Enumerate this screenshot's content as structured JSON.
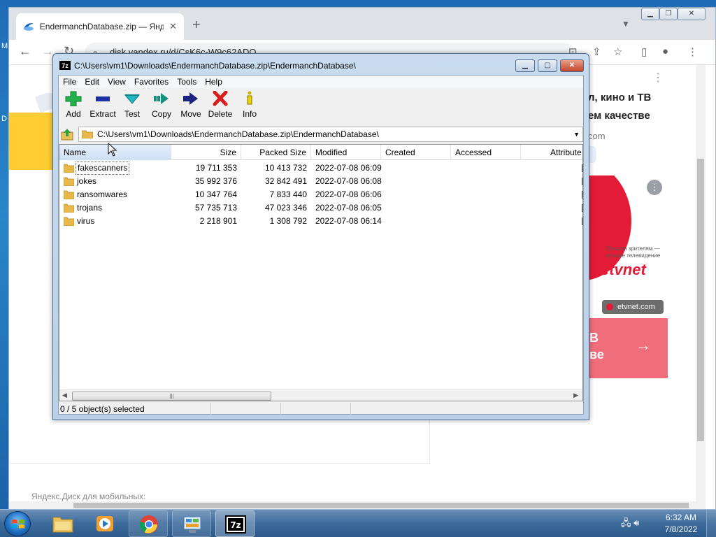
{
  "browser": {
    "tab_title": "EndermanchDatabase.zip — Яндекс.Диск",
    "url": "disk.yandex.ru/d/CsK6c-W9c62ADQ",
    "tab_close": "✕",
    "new_tab": "+",
    "page": {
      "promo_line1": "л, кино и ТВ",
      "promo_line2": "ем качестве",
      "promo_line3": "com",
      "ad_tagline": "Лучшим зрителям — лучшее телевидение",
      "ad_logo": "etvnet",
      "ad_domain": "etvnet.com",
      "ad_bottom_line1": "В",
      "ad_bottom_line2": "ве",
      "footer": "Яндекс.Диск для мобильных:"
    }
  },
  "desktop": {
    "edge_label_m": "M",
    "edge_label_d": "D"
  },
  "zip": {
    "title": "C:\\Users\\vm1\\Downloads\\EndermanchDatabase.zip\\EndermanchDatabase\\",
    "app_icon": "7z",
    "menu": [
      "File",
      "Edit",
      "View",
      "Favorites",
      "Tools",
      "Help"
    ],
    "toolbar": [
      {
        "label": "Add",
        "icon": "add-icon"
      },
      {
        "label": "Extract",
        "icon": "extract-icon"
      },
      {
        "label": "Test",
        "icon": "test-icon"
      },
      {
        "label": "Copy",
        "icon": "copy-icon"
      },
      {
        "label": "Move",
        "icon": "move-icon"
      },
      {
        "label": "Delete",
        "icon": "delete-icon"
      },
      {
        "label": "Info",
        "icon": "info-icon"
      }
    ],
    "address": "C:\\Users\\vm1\\Downloads\\EndermanchDatabase.zip\\EndermanchDatabase\\",
    "columns": [
      "Name",
      "Size",
      "Packed Size",
      "Modified",
      "Created",
      "Accessed",
      "Attributes"
    ],
    "rows": [
      {
        "name": "fakescanners",
        "size": "19 711 353",
        "packed": "10 413 732",
        "modified": "2022-07-08 06:09"
      },
      {
        "name": "jokes",
        "size": "35 992 376",
        "packed": "32 842 491",
        "modified": "2022-07-08 06:08"
      },
      {
        "name": "ransomwares",
        "size": "10 347 764",
        "packed": "7 833 440",
        "modified": "2022-07-08 06:06"
      },
      {
        "name": "trojans",
        "size": "57 735 713",
        "packed": "47 023 346",
        "modified": "2022-07-08 06:05"
      },
      {
        "name": "virus",
        "size": "2 218 901",
        "packed": "1 308 792",
        "modified": "2022-07-08 06:14"
      }
    ],
    "status": "0 / 5 object(s) selected"
  },
  "taskbar": {
    "time": "6:32 AM",
    "date": "7/8/2022"
  },
  "colors": {
    "add": "#22b14c",
    "extract": "#1f2fa8",
    "test": "#20b8c0",
    "copy": "#168f7e",
    "move": "#1a237e",
    "delete": "#d81b1b",
    "info": "#c8b400",
    "folder": "#e8b84a"
  }
}
